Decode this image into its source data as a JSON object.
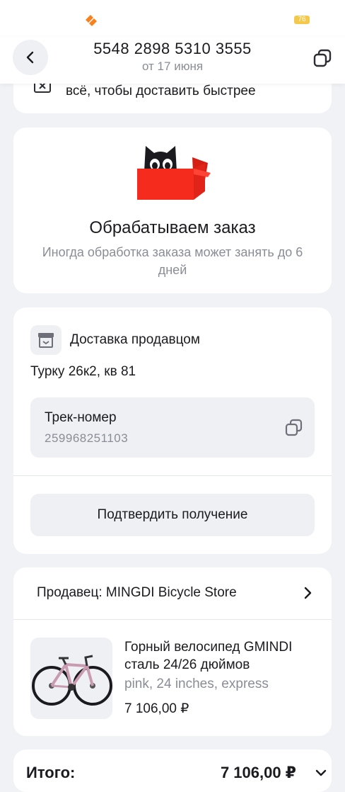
{
  "status_bar": {
    "battery": "76"
  },
  "header": {
    "order_number": "5548 2898 5310 3555",
    "order_date": "от 17 июня"
  },
  "top_card": {
    "text": "всё, чтобы доставить быстрее"
  },
  "processing": {
    "title": "Обрабатываем заказ",
    "subtitle": "Иногда обработка заказа может занять до 6 дней"
  },
  "delivery": {
    "title": "Доставка продавцом",
    "address": "Турку 26к2, кв 81",
    "track_label": "Трек-номер",
    "track_number": "259968251103",
    "confirm_label": "Подтвердить получение"
  },
  "seller": {
    "label": "Продавец: MINGDI Bicycle Store",
    "product": {
      "title": "Горный велосипед GMINDI сталь 24/26 дюймов",
      "variant": "pink, 24 inches, express",
      "price": "7 106,00 ₽"
    }
  },
  "total": {
    "label": "Итого:",
    "value": "7 106,00 ₽"
  },
  "colors": {
    "brand_red": "#f52b1e",
    "background": "#f1f2f5",
    "muted": "#8a8d96",
    "accent_orange": "#f5821f"
  }
}
